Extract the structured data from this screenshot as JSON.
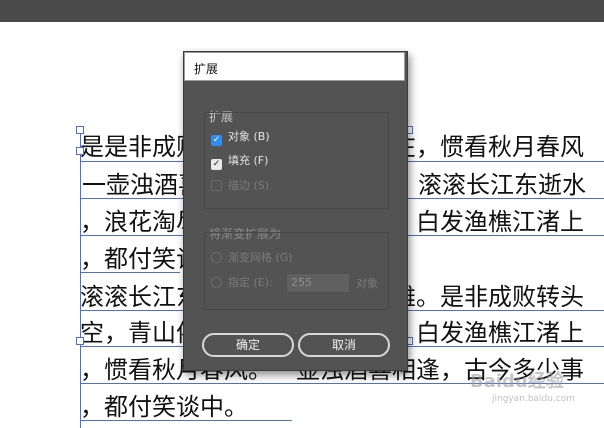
{
  "canvas": {
    "lines": [
      "是是非成败转头空，青山依旧在，惯看秋月春风",
      "一壶浊酒喜相逢，古今多少事，滚滚长江东逝水",
      "，浪花淘尽英雄。几度夕阳红。白发渔樵江渚上",
      "，都付笑谈中。",
      "滚滚长江东逝水，浪花淘尽英雄。是非成败转头",
      "空，青山依旧在，几度夕阳红。白发渔樵江渚上",
      "，惯看秋月春风。一壶浊酒喜相逢，古今多少事",
      "，都付笑谈中。"
    ]
  },
  "dialog": {
    "title": "扩展",
    "expand_group": {
      "label": "扩展",
      "options": [
        {
          "label": "对象 (B)",
          "checked": true
        },
        {
          "label": "填充 (F)",
          "checked": true
        },
        {
          "label": "描边 (S)",
          "checked": false,
          "disabled": true
        }
      ]
    },
    "gradient_group": {
      "label": "将渐变扩展为",
      "gradient_mesh_label": "渐变网格 (G)",
      "specify_label": "指定 (E):",
      "specify_value": "255",
      "specify_unit": "对象"
    },
    "ok_label": "确定",
    "cancel_label": "取消"
  },
  "watermark": {
    "text": "Baidu经验",
    "sub": "jingyan.baidu.com"
  },
  "colors": {
    "dialog_bg": "#535353",
    "selection_blue": "#4a6fd6",
    "checkbox_blue": "#2f8cf0"
  }
}
